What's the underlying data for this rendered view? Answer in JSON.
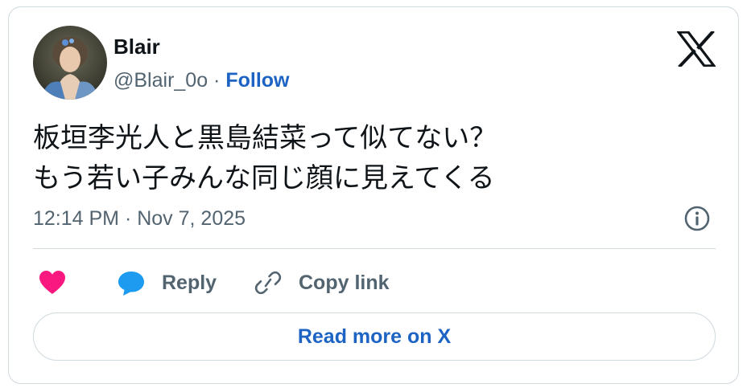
{
  "author": {
    "name": "Blair",
    "handle": "@Blair_0o",
    "separator": " · ",
    "follow_label": "Follow"
  },
  "tweet": {
    "lines": [
      "板垣李光人と黒島結菜って似てない？",
      "もう若い子みんな同じ顔に見えてくる"
    ],
    "timestamp": "12:14 PM · Nov 7, 2025"
  },
  "actions": {
    "reply_label": "Reply",
    "copy_link_label": "Copy link"
  },
  "read_more_label": "Read more on X",
  "icons": {
    "brand": "x-logo-icon",
    "info": "info-icon",
    "like": "heart-icon",
    "reply": "speech-bubble-icon",
    "copy": "link-icon"
  },
  "colors": {
    "link_blue": "#1d63c4",
    "heart_pink": "#f91880",
    "reply_blue": "#1d9bf0",
    "muted_text": "#536471",
    "border": "#cfd9de"
  }
}
